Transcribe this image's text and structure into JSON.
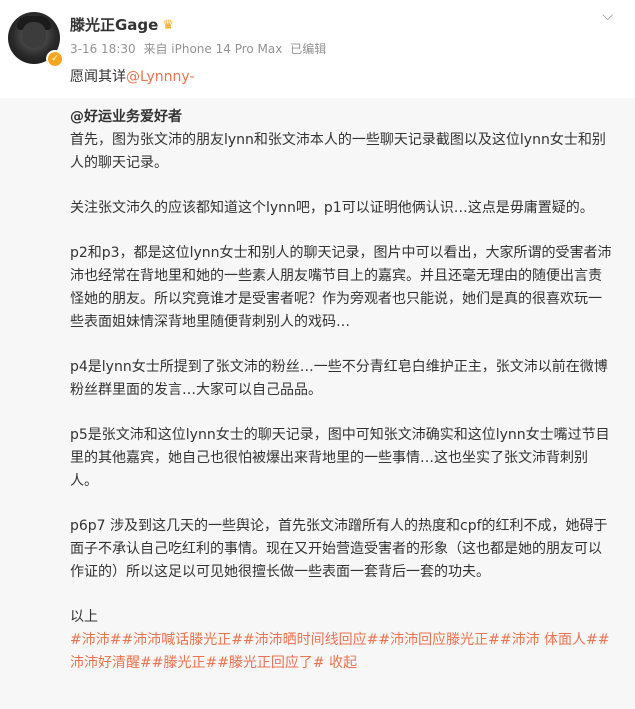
{
  "user": {
    "name": "滕光正Gage",
    "crown_icon": "crown-icon",
    "verified_icon": "verified-badge-icon"
  },
  "meta": {
    "time": "3-16 18:30",
    "source": "来自 iPhone 14 Pro Max",
    "edited": "已编辑"
  },
  "lead": {
    "text": "愿闻其详",
    "mention": "@Lynnny-"
  },
  "repost": {
    "author": "@好运业务爱好者",
    "paragraphs": [
      "首先，图为张文沛的朋友lynn和张文沛本人的一些聊天记录截图以及这位lynn女士和别人的聊天记录。",
      "关注张文沛久的应该都知道这个lynn吧，p1可以证明他俩认识…这点是毋庸置疑的。",
      "p2和p3，都是这位lynn女士和别人的聊天记录，图片中可以看出，大家所谓的受害者沛沛也经常在背地里和她的一些素人朋友嘴节目上的嘉宾。并且还毫无理由的随便出言责怪她的朋友。所以究竟谁才是受害者呢？作为旁观者也只能说，她们是真的很喜欢玩一些表面姐妹情深背地里随便背刺别人的戏码…",
      "p4是lynn女士所提到了张文沛的粉丝…一些不分青红皂白维护正主，张文沛以前在微博粉丝群里面的发言…大家可以自己品品。",
      "p5是张文沛和这位lynn女士的聊天记录，图中可知张文沛确实和这位lynn女士嘴过节目里的其他嘉宾，她自己也很怕被爆出来背地里的一些事情…这也坐实了张文沛背刺别人。",
      "p6p7 涉及到这几天的一些舆论，首先张文沛蹭所有人的热度和cpf的红利不成，她碍于面子不承认自己吃红利的事情。现在又开始营造受害者的形象（这也都是她的朋友可以作证的）所以这足以可见她很擅长做一些表面一套背后一套的功夫。",
      "以上"
    ],
    "tags": "#沛沛##沛沛喊话滕光正##沛沛晒时间线回应##沛沛回应滕光正##沛沛 体面人##沛沛好清醒##滕光正##滕光正回应了#",
    "collapse_label": "收起"
  },
  "colors": {
    "accent": "#eb7350",
    "repost_bg": "#f7f7f7",
    "meta_text": "#939393"
  }
}
